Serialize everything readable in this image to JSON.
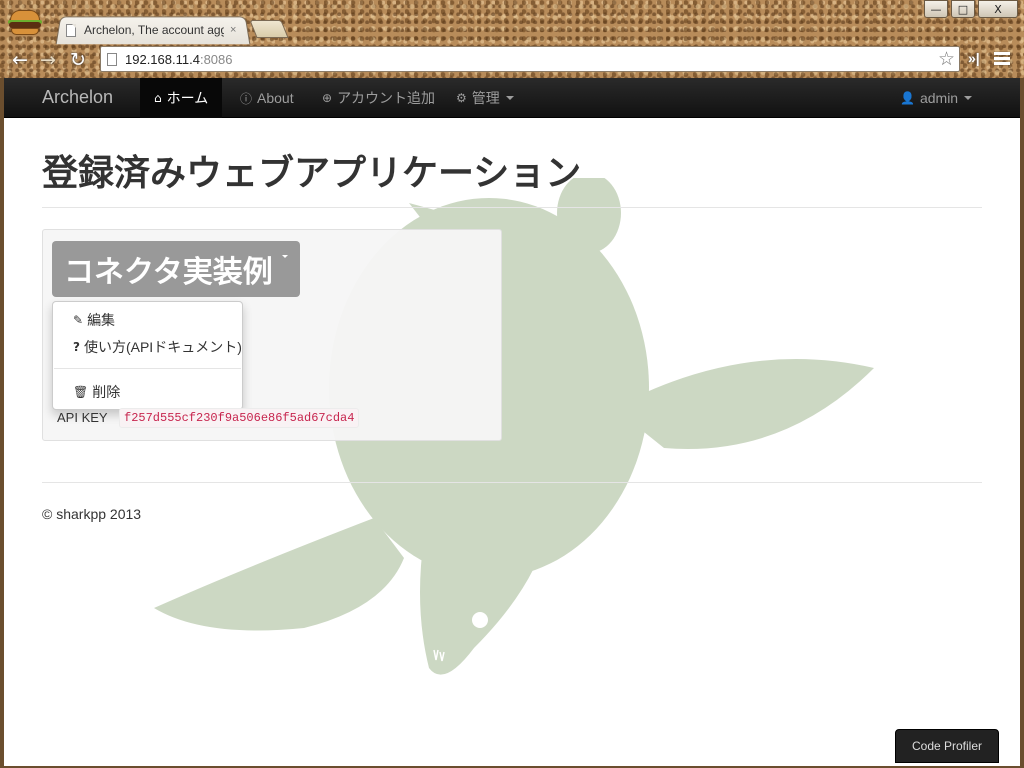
{
  "browser": {
    "tab_title": "Archelon, The account agg",
    "tab_close": "×",
    "url_host": "192.168.11.4",
    "url_port": ":8086",
    "back_icon": "arrow-left-icon",
    "forward_icon": "arrow-right-icon",
    "reload_icon": "reload-icon",
    "bookmark_icon": "star-icon",
    "extension_label": "»|",
    "window_buttons": {
      "minimize": "—",
      "maximize": "□",
      "close": "X"
    }
  },
  "navbar": {
    "brand": "Archelon",
    "items": [
      {
        "label": "ホーム",
        "icon": "home-icon",
        "active": true
      },
      {
        "label": "About",
        "icon": "info-icon"
      },
      {
        "label": "アカウント追加",
        "icon": "plus-circle-icon"
      },
      {
        "label": "管理",
        "icon": "gear-icon",
        "dropdown": true
      }
    ],
    "user": {
      "label": "admin",
      "icon": "user-icon"
    }
  },
  "main": {
    "page_title": "登録済みウェブアプリケーション",
    "app": {
      "name": "コネクタ実装例",
      "menu": [
        {
          "label": "編集",
          "icon": "pencil-icon"
        },
        {
          "label": "使い方(APIドキュメント)",
          "icon": "question-icon"
        },
        {
          "label": "削除",
          "icon": "trash-icon"
        }
      ],
      "api_key_label": "API KEY",
      "api_key": "f257d555cf230f9a506e86f5ad67cda4"
    },
    "footer": "© sharkpp 2013"
  },
  "profiler": {
    "label": "Code Profiler"
  },
  "colors": {
    "navbar_bg": "#1b1b1b",
    "turtle": "#ccd8c3",
    "button_bg": "#999999",
    "code_color": "#c7254e"
  }
}
